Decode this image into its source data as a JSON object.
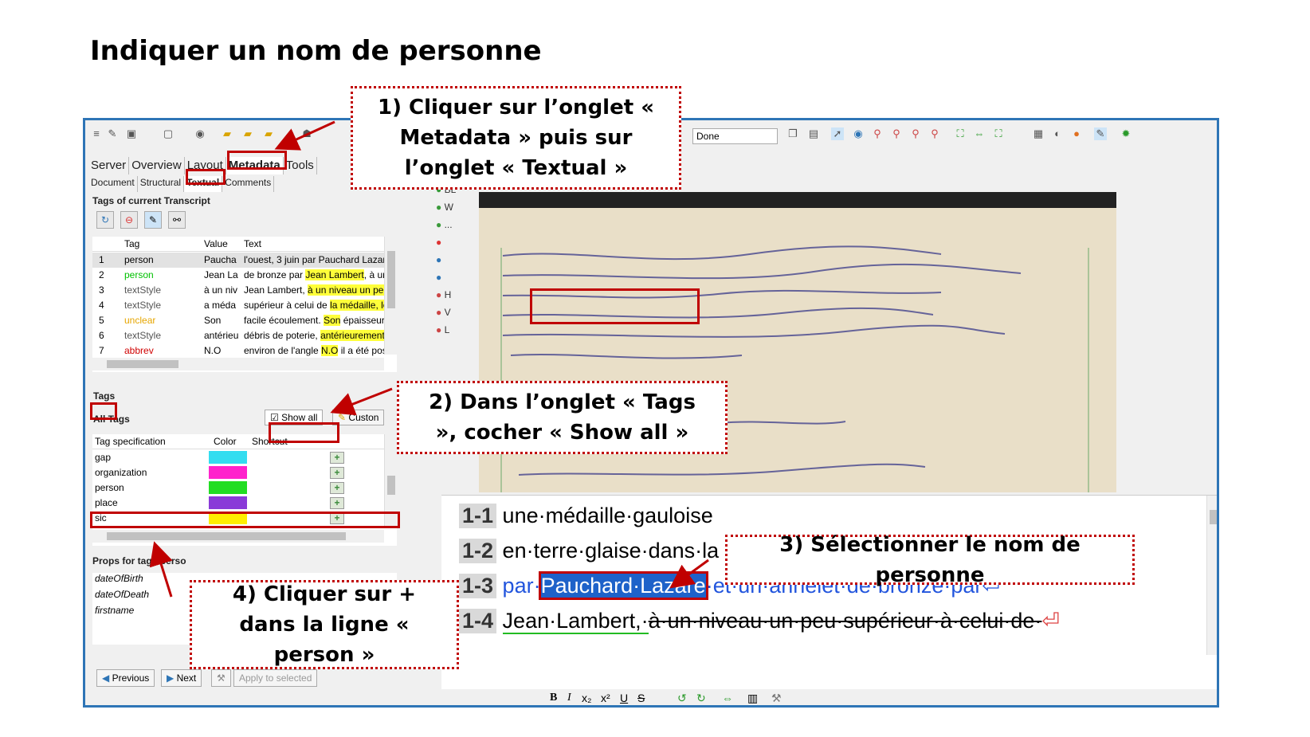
{
  "page": {
    "title": "Indiquer un nom de personne"
  },
  "toolbar": {
    "status_select": "Done"
  },
  "tabs_main": [
    "Server",
    "Overview",
    "Layout",
    "Metadata",
    "Tools"
  ],
  "tabs_meta": [
    "Document",
    "Structural",
    "Textual",
    "Comments"
  ],
  "tags_panel": {
    "title": "Tags of current Transcript",
    "columns": [
      "Tag",
      "Value",
      "Text"
    ],
    "rows": [
      {
        "n": "1",
        "tag": "person",
        "value": "Paucha",
        "text": "l'ouest, 3 juin par Pauchard Lazare,",
        "tag_color": "#000000"
      },
      {
        "n": "2",
        "tag": "person",
        "value": "Jean La",
        "text_pre": "de bronze par ",
        "text_hl": "Jean Lambert",
        "text_post": ", à un n",
        "tag_color": "#00c000"
      },
      {
        "n": "3",
        "tag": "textStyle",
        "value": "à un niv",
        "text_pre": "Jean Lambert, ",
        "text_hl": "à un niveau un peu s",
        "text_post": "",
        "tag_color": "#555555"
      },
      {
        "n": "4",
        "tag": "textStyle",
        "value": "a méda",
        "text_pre": "supérieur à celui de ",
        "text_hl": "la médaille, le",
        "text_post": "",
        "tag_color": "#555555"
      },
      {
        "n": "5",
        "tag": "unclear",
        "value": "Son",
        "text_pre": "facile écoulement. ",
        "text_hl": "Son",
        "text_post": " épaisseur, a",
        "tag_color": "#e6a600"
      },
      {
        "n": "6",
        "tag": "textStyle",
        "value": "antérieu",
        "text_pre": "débris de poterie, ",
        "text_hl": "antérieurement",
        "text_post": " r",
        "tag_color": "#555555"
      },
      {
        "n": "7",
        "tag": "abbrev",
        "value": "N.O",
        "text_pre": "environ de l'angle ",
        "text_hl": "N.O",
        "text_post": " il a été poss",
        "tag_color": "#d00000"
      }
    ]
  },
  "tags_section": {
    "tab_label": "Tags",
    "all_tags_label": "All Tags",
    "show_all_label": "Show all",
    "customize_label": "Custon",
    "columns": [
      "Tag specification",
      "Color",
      "Shortcut"
    ],
    "specs": [
      {
        "name": "gap",
        "color": "#33ddf0"
      },
      {
        "name": "organization",
        "color": "#ff22cc"
      },
      {
        "name": "person",
        "color": "#22dd22"
      },
      {
        "name": "place",
        "color": "#8a3ad8"
      },
      {
        "name": "sic",
        "color": "#ffee00"
      }
    ],
    "props_title": "Props for tag: 'perso",
    "props": [
      "dateOfBirth",
      "dateOfDeath",
      "firstname"
    ]
  },
  "nav": {
    "previous": "Previous",
    "next": "Next",
    "apply": "Apply to selected"
  },
  "side_tools": [
    "BL",
    "W",
    "...",
    "",
    "",
    "",
    "H",
    "V",
    "L"
  ],
  "transcript": [
    {
      "num": "1-1",
      "text": "une·médaille·gauloise"
    },
    {
      "num": "1-2",
      "text": "en·terre·glaise·dans·la"
    },
    {
      "num": "1-3",
      "pre": "par·",
      "sel": "Pauchard·Lazare",
      "post": "·et·un·annelet·de·bronze·par⏎"
    },
    {
      "num": "1-4",
      "pre": "Jean·Lambert,·",
      "strike": "à·un·niveau·un·peu·supérieur·à·celui·de·",
      "post": "⏎"
    }
  ],
  "callouts": {
    "c1": "1) Cliquer sur l’onglet « Metadata » puis sur l’onglet « Textual »",
    "c2": "2) Dans l’onglet « Tags », cocher « Show all »",
    "c3": "3) Sélectionner le nom de personne",
    "c4": "4) Cliquer sur + dans la ligne « person »"
  }
}
